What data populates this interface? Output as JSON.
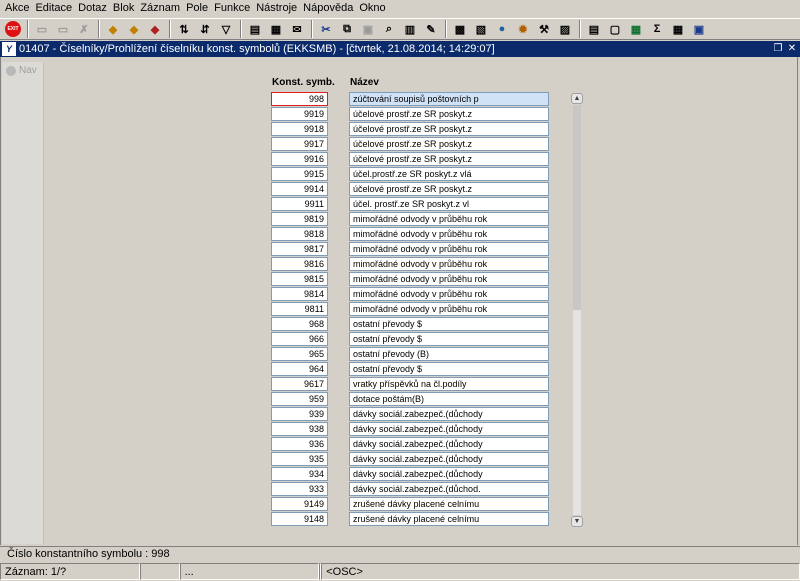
{
  "menu": [
    "Akce",
    "Editace",
    "Dotaz",
    "Blok",
    "Záznam",
    "Pole",
    "Funkce",
    "Nástroje",
    "Nápověda",
    "Okno"
  ],
  "toolbar": {
    "exit_label": "EXIT",
    "icons": [
      "save-icon",
      "print-icon",
      "cut-icon",
      "copy-icon",
      "paste-icon",
      "clear-icon",
      "sort-icon",
      "sort-desc-icon",
      "filter-icon",
      "print-preview-icon",
      "attach-icon",
      "mail-icon",
      "scissors-icon",
      "undo-icon",
      "calculator-icon",
      "tools-icon",
      "help-icon",
      "image-icon",
      "report-icon",
      "globe-icon",
      "settings-icon",
      "graph-icon",
      "document-icon",
      "excel-icon",
      "sum-icon",
      "calendar-icon",
      "window-icon"
    ],
    "sum_symbol": "Σ"
  },
  "window": {
    "title": "01407 - Číselníky/Prohlížení číselníku konst. symbolů (EKKSMB) - [čtvrtek, 21.08.2014; 14:29:07]",
    "app_icon": "Y",
    "restore_glyph": "❐",
    "close_glyph": "✕"
  },
  "nav": {
    "label": "Nav"
  },
  "table": {
    "header_code": "Konst. symb.",
    "header_name": "Název",
    "rows": [
      {
        "code": "998",
        "name": "zúčtování soupisů poštovních p"
      },
      {
        "code": "9919",
        "name": "účelové prostř.ze SR poskyt.z"
      },
      {
        "code": "9918",
        "name": "účelové prostř.ze SR poskyt.z"
      },
      {
        "code": "9917",
        "name": "účelové prostř.ze SR poskyt.z"
      },
      {
        "code": "9916",
        "name": "účelové prostř.ze SR poskyt.z"
      },
      {
        "code": "9915",
        "name": "účel.prostř.ze SR poskyt.z vlá"
      },
      {
        "code": "9914",
        "name": "účelové prostř.ze SR poskyt.z"
      },
      {
        "code": "9911",
        "name": "účel. prostř.ze SR poskyt.z vl"
      },
      {
        "code": "9819",
        "name": "mimořádné odvody v průběhu rok"
      },
      {
        "code": "9818",
        "name": "mimořádné odvody v průběhu rok"
      },
      {
        "code": "9817",
        "name": "mimořádné odvody v průběhu rok"
      },
      {
        "code": "9816",
        "name": "mimořádné odvody v průběhu rok"
      },
      {
        "code": "9815",
        "name": "mimořádné odvody v průběhu rok"
      },
      {
        "code": "9814",
        "name": "mimořádné odvody v průběhu rok"
      },
      {
        "code": "9811",
        "name": "mimořádné odvody v průběhu rok"
      },
      {
        "code": "968",
        "name": "ostatní převody $"
      },
      {
        "code": "966",
        "name": "ostatní převody $"
      },
      {
        "code": "965",
        "name": "ostatní převody (B)"
      },
      {
        "code": "964",
        "name": "ostatní převody $"
      },
      {
        "code": "9617",
        "name": "vratky příspěvků na čl.podíly"
      },
      {
        "code": "959",
        "name": "dotace poštám(B)"
      },
      {
        "code": "939",
        "name": "dávky sociál.zabezpeč.(důchody"
      },
      {
        "code": "938",
        "name": "dávky sociál.zabezpeč.(důchody"
      },
      {
        "code": "936",
        "name": "dávky sociál.zabezpeč.(důchody"
      },
      {
        "code": "935",
        "name": "dávky sociál.zabezpeč.(důchody"
      },
      {
        "code": "934",
        "name": "dávky sociál.zabezpeč.(důchody"
      },
      {
        "code": "933",
        "name": "dávky sociál.zabezpeč.(důchod."
      },
      {
        "code": "9149",
        "name": "zrušené dávky placené celnímu"
      },
      {
        "code": "9148",
        "name": "zrušené dávky placené celnímu"
      }
    ]
  },
  "scroll": {
    "up_glyph": "▲",
    "down_glyph": "▼"
  },
  "status": {
    "message": "Číslo konstantního symbolu : 998",
    "record": "Záznam: 1/?",
    "seg2": "",
    "seg3": "...",
    "seg4": "",
    "mode": "<OSC>"
  }
}
